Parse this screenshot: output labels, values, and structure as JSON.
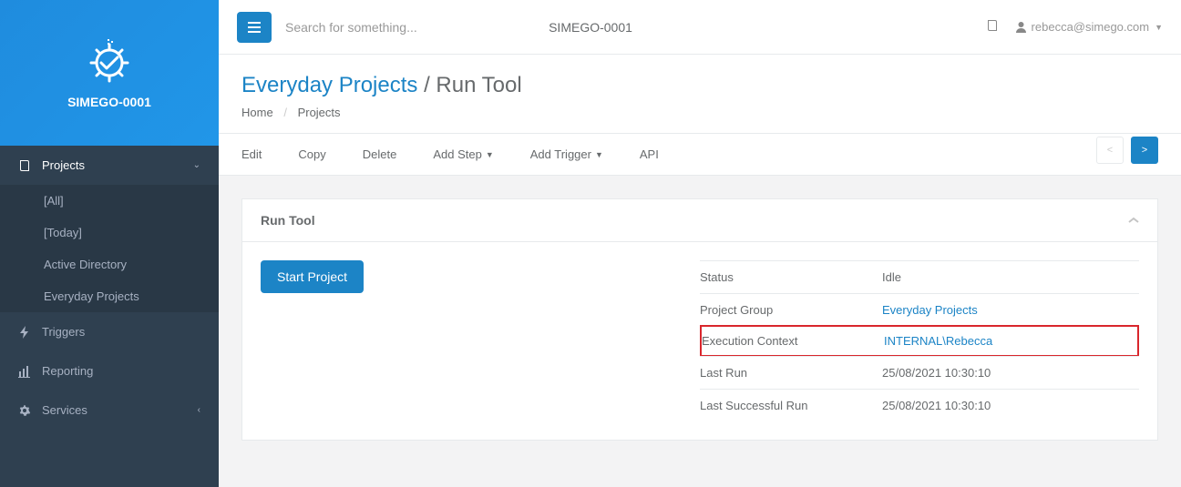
{
  "sidebar": {
    "brand": "SIMEGO-0001",
    "items": [
      {
        "label": "Projects",
        "icon": "book"
      },
      {
        "label": "Triggers",
        "icon": "bolt"
      },
      {
        "label": "Reporting",
        "icon": "chart"
      },
      {
        "label": "Services",
        "icon": "gear"
      }
    ],
    "projects_sub": [
      {
        "label": "[All]"
      },
      {
        "label": "[Today]"
      },
      {
        "label": "Active Directory"
      },
      {
        "label": "Everyday Projects"
      }
    ]
  },
  "topbar": {
    "search_placeholder": "Search for something...",
    "title": "SIMEGO-0001",
    "user": "rebecca@simego.com"
  },
  "page": {
    "title_primary": "Everyday Projects",
    "title_sep": "/",
    "title_secondary": "Run Tool",
    "breadcrumb": [
      "Home",
      "Projects"
    ],
    "nav_prev": "<",
    "nav_next": ">"
  },
  "toolbar": {
    "edit": "Edit",
    "copy": "Copy",
    "delete": "Delete",
    "add_step": "Add Step",
    "add_trigger": "Add Trigger",
    "api": "API"
  },
  "panel": {
    "title": "Run Tool",
    "start_button": "Start Project",
    "rows": [
      {
        "label": "Status",
        "value": "Idle",
        "link": false
      },
      {
        "label": "Project Group",
        "value": "Everyday Projects",
        "link": true
      },
      {
        "label": "Execution Context",
        "value": "INTERNAL\\Rebecca",
        "link": true,
        "highlight": true
      },
      {
        "label": "Last Run",
        "value": "25/08/2021 10:30:10",
        "link": false
      },
      {
        "label": "Last Successful Run",
        "value": "25/08/2021 10:30:10",
        "link": false
      }
    ]
  }
}
